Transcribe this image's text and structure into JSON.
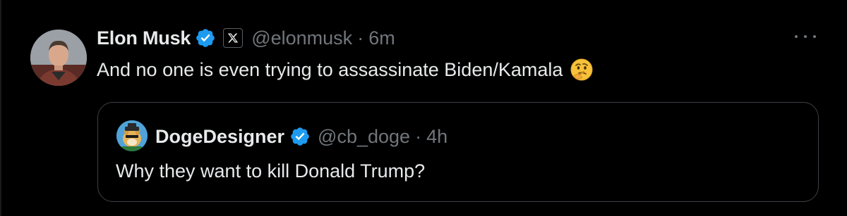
{
  "tweet": {
    "author_name": "Elon Musk",
    "handle": "@elonmusk",
    "separator": "·",
    "time": "6m",
    "text": "And no one is even trying to assassinate Biden/Kamala",
    "emoji_icon": "thinking-face-emoji",
    "verified_icon": "verified-badge-icon",
    "affiliation_icon": "x-logo-icon",
    "more_icon": "more-options-icon"
  },
  "quoted_tweet": {
    "author_name": "DogeDesigner",
    "handle": "@cb_doge",
    "separator": "·",
    "time": "4h",
    "text": "Why they want to kill Donald Trump?",
    "verified_icon": "verified-badge-icon"
  },
  "colors": {
    "background": "#000000",
    "primary_text": "#e7e9ea",
    "secondary_text": "#71767b",
    "verified_blue": "#1d9bf0",
    "quote_border": "#3b4046"
  }
}
